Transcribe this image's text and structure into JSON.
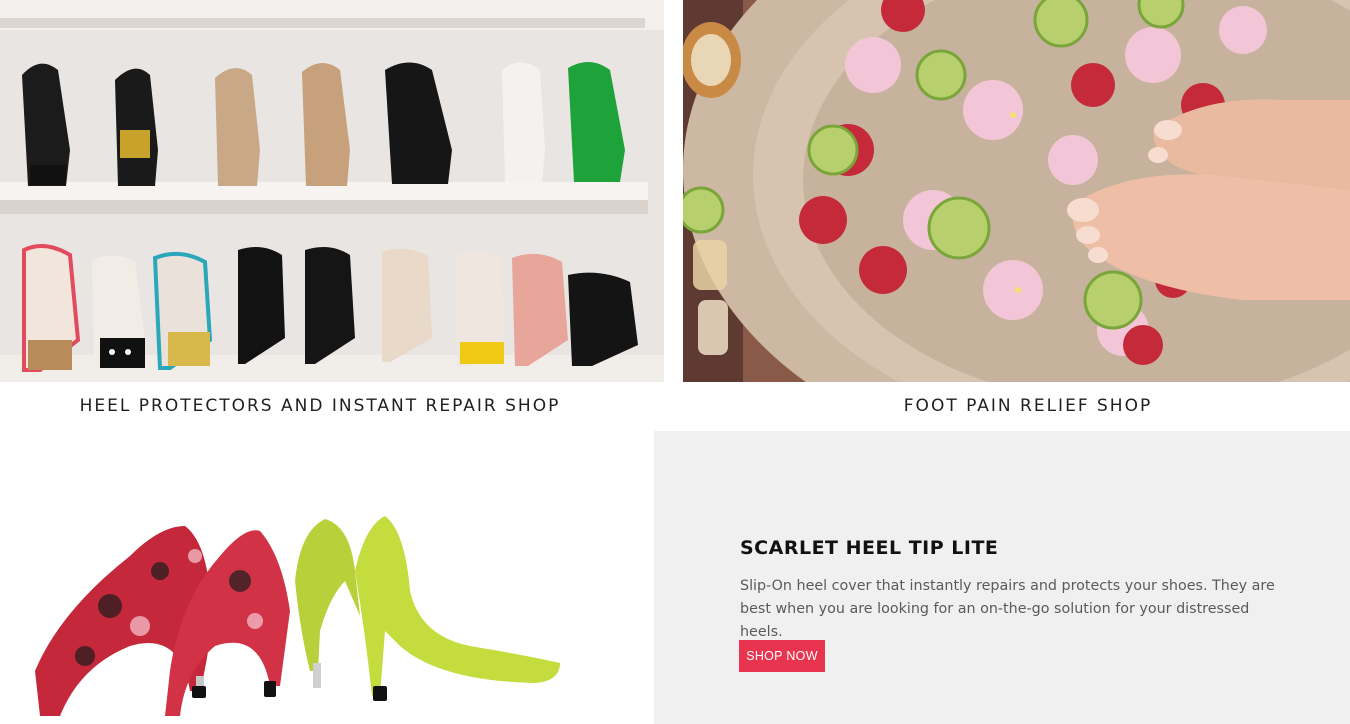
{
  "categories": [
    {
      "label": "HEEL PROTECTORS AND INSTANT REPAIR SHOP",
      "image": "heels-on-shelves-photo"
    },
    {
      "label": "FOOT PAIN RELIEF SHOP",
      "image": "foot-spa-bowl-photo"
    }
  ],
  "promo": {
    "title": "SCARLET HEEL TIP LITE",
    "description": "Slip-On heel cover that instantly repairs and protects your shoes. They are best when you are looking for an on-the-go solution for your distressed heels.",
    "button_label": "SHOP NOW",
    "image": "pumps-with-heel-tips-photo"
  },
  "colors": {
    "accent": "#e8344e",
    "panel_bg": "#f0f0f0",
    "text_dark": "#111111",
    "text_muted": "#5a5a5a"
  }
}
